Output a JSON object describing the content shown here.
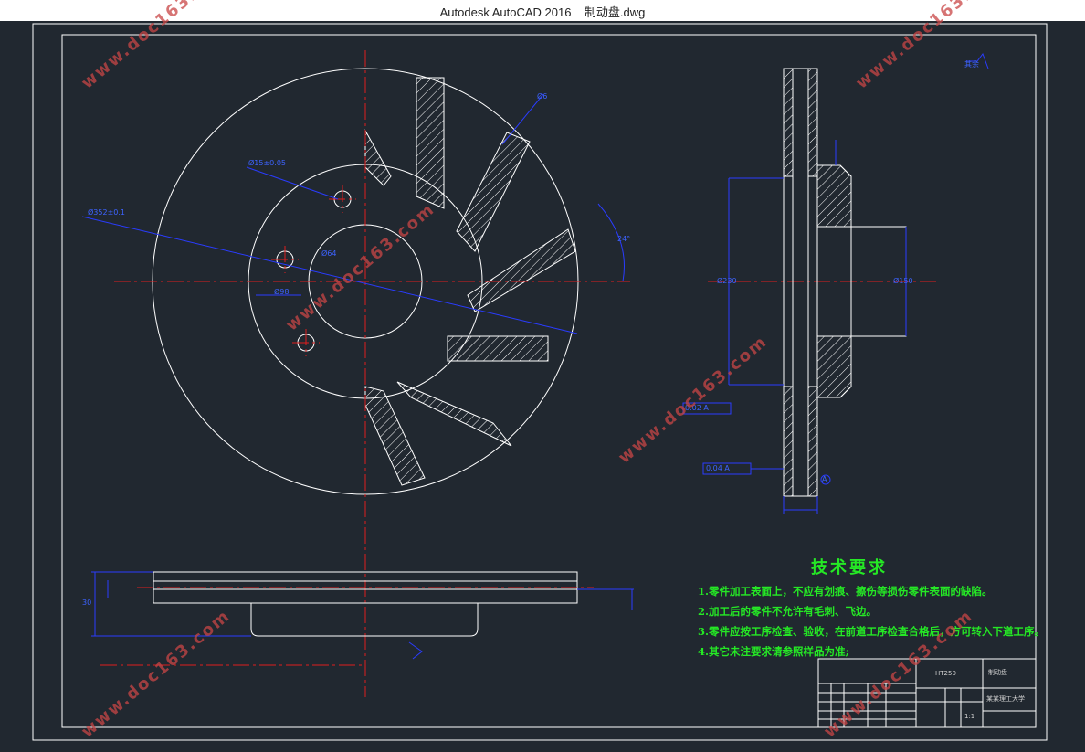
{
  "window": {
    "title": "Autodesk AutoCAD 2016    制动盘.dwg"
  },
  "tech_requirements": {
    "heading": "技术要求",
    "items": [
      "1.零件加工表面上，不应有划痕、擦伤等损伤零件表面的缺陷。",
      "2.加工后的零件不允许有毛刺、飞边。",
      "3.零件应按工序检查、验收，在前道工序检查合格后，方可转入下道工序。",
      "4.其它未注要求请参照样品为准;"
    ]
  },
  "dimensions": {
    "hole_dia": "Ø15±0.05",
    "outer_dia": "Ø352±0.1",
    "center_dia": "Ø64",
    "bolt_circle": "Ø98",
    "angle": "24°",
    "top_width": "Ø6",
    "right_h1": "Ø230",
    "right_h2": "Ø150",
    "parallel": "0.02 A",
    "runout": "0.04 A",
    "thickness": "30",
    "roughness_note": "其余",
    "datum": "A"
  },
  "title_block": {
    "part_name": "制动盘",
    "company": "某某理工大学",
    "scale": "1:1",
    "material": "HT250"
  },
  "watermark": "www.doc163.com",
  "colors": {
    "model_bg": "#212830",
    "lines": "#ffffff",
    "dimension": "#2a3cff",
    "center": "#e01e1e",
    "text_green": "#25e825",
    "watermark": "#c84646"
  }
}
